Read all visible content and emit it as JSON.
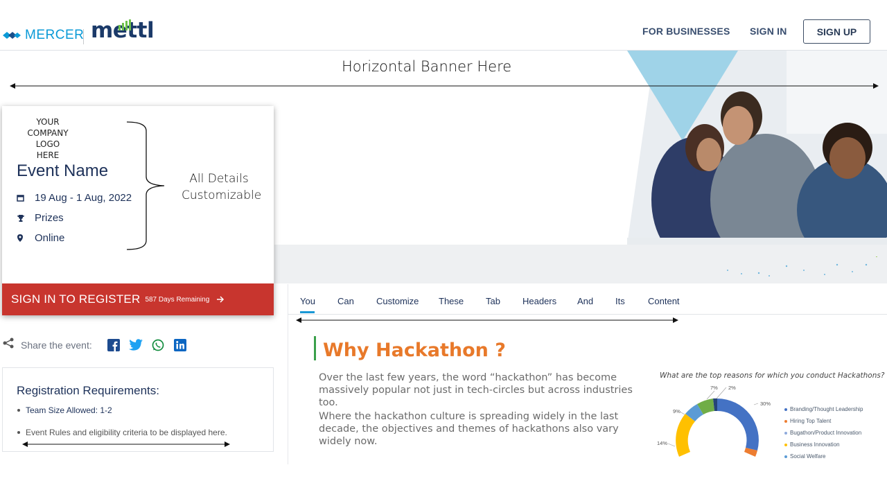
{
  "header": {
    "mercer_text": "MERCER",
    "mettl_text": "mettl",
    "nav_business": "FOR BUSINESSES",
    "nav_signin": "SIGN IN",
    "signup_label": "SIGN UP"
  },
  "banner": {
    "label": "Horizontal Banner Here"
  },
  "event": {
    "company_logo": "YOUR COMPANY LOGO HERE",
    "name": "Event Name",
    "dates": "19 Aug - 1 Aug, 2022",
    "prizes": "Prizes",
    "location": "Online",
    "customizable_note": "All Details Customizable",
    "register_label": "SIGN IN TO REGISTER",
    "days_remaining": "587 Days Remaining"
  },
  "share": {
    "label": "Share the event:"
  },
  "requirements": {
    "title": "Registration Requirements:",
    "items": [
      "Team Size Allowed: 1-2",
      "Event Rules and eligibility criteria to be displayed here."
    ]
  },
  "tabs": [
    {
      "label": "You"
    },
    {
      "label": "Can"
    },
    {
      "label": "Customize"
    },
    {
      "label": "These"
    },
    {
      "label": "Tab"
    },
    {
      "label": "Headers"
    },
    {
      "label": "And"
    },
    {
      "label": "Its"
    },
    {
      "label": "Content"
    }
  ],
  "content": {
    "title": "Why Hackathon ?",
    "para1": "Over the last few years, the word “hackathon” has become massively popular not just in tech-circles but across industries too.",
    "para2": "Where the hackathon culture is spreading widely in the last decade, the objectives and themes of hackathons also vary widely now."
  },
  "chart_data": {
    "type": "pie",
    "title": "What are the top reasons for which you conduct Hackathons?",
    "legend": [
      {
        "name": "Branding/Thought Leadership",
        "color": "#4472c4"
      },
      {
        "name": "Hiring Top Talent",
        "color": "#ed7d31"
      },
      {
        "name": "Bugathon/Product Innovation",
        "color": "#8faadc"
      },
      {
        "name": "Business Innovation",
        "color": "#ffc000"
      },
      {
        "name": "Social Welfare",
        "color": "#5b9bd5"
      }
    ],
    "visible_labels": [
      "30%",
      "14%",
      "9%",
      "7%",
      "2%"
    ]
  },
  "colors": {
    "register_bar": "#c8352e",
    "accent_blue": "#1a98d5",
    "title_orange": "#e8792a",
    "title_green": "#3aa04a"
  }
}
